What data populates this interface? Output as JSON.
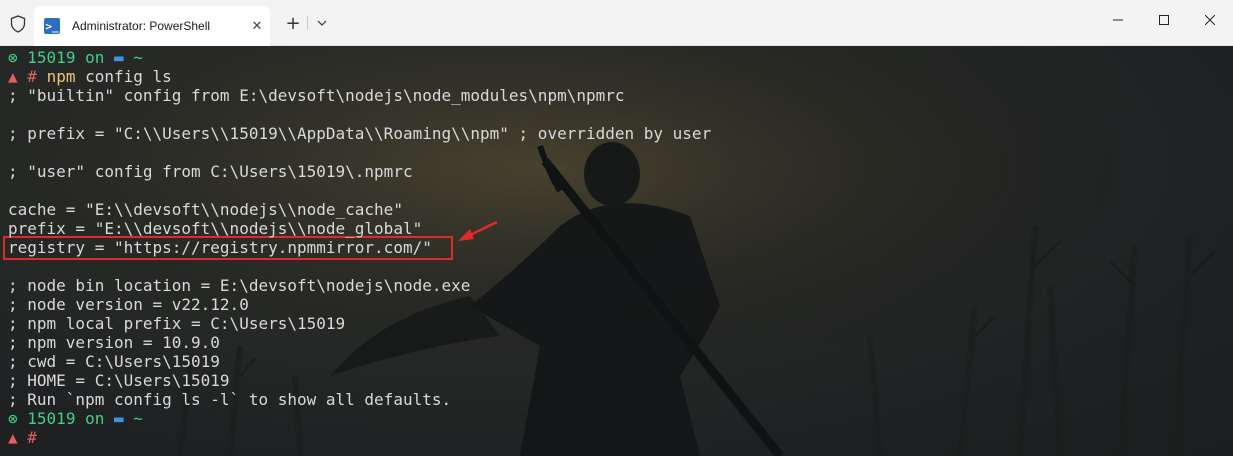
{
  "window": {
    "tab_title": "Administrator: PowerShell",
    "tab_icon": "powershell-icon",
    "new_tab_symbol": "+",
    "close_symbol": "✕",
    "colors": {
      "titlebar": "#f3f3f3",
      "terminal_text": "#d9d9d9",
      "prompt_green": "#3fd08a",
      "prompt_red": "#e05f5f",
      "command_yellow": "#f0c674",
      "highlight_border": "#e02a2a"
    }
  },
  "terminal": {
    "prompt1": {
      "status": "⊗",
      "user": "15019",
      "on": "on",
      "folder_icon": "folder-icon",
      "dir": "~"
    },
    "prompt1_cmd": {
      "mark": "▲",
      "hash": "#",
      "cmd": "npm",
      "args": "config ls"
    },
    "lines": [
      "; \"builtin\" config from E:\\devsoft\\nodejs\\node_modules\\npm\\npmrc",
      "",
      "; prefix = \"C:\\\\Users\\\\15019\\\\AppData\\\\Roaming\\\\npm\" ; overridden by user",
      "",
      "; \"user\" config from C:\\Users\\15019\\.npmrc",
      "",
      "cache = \"E:\\\\devsoft\\\\nodejs\\\\node_cache\"",
      "prefix = \"E:\\\\devsoft\\\\nodejs\\\\node_global\"",
      "registry = \"https://registry.npmmirror.com/\"",
      "",
      "; node bin location = E:\\devsoft\\nodejs\\node.exe",
      "; node version = v22.12.0",
      "; npm local prefix = C:\\Users\\15019",
      "; npm version = 10.9.0",
      "; cwd = C:\\Users\\15019",
      "; HOME = C:\\Users\\15019",
      "; Run `npm config ls -l` to show all defaults."
    ],
    "prompt2": {
      "status": "⊗",
      "user": "15019",
      "on": "on",
      "folder_icon": "folder-icon",
      "dir": "~"
    },
    "prompt2_cmd": {
      "mark": "▲",
      "hash": "#"
    },
    "annotation": "red-arrow-highlight"
  }
}
